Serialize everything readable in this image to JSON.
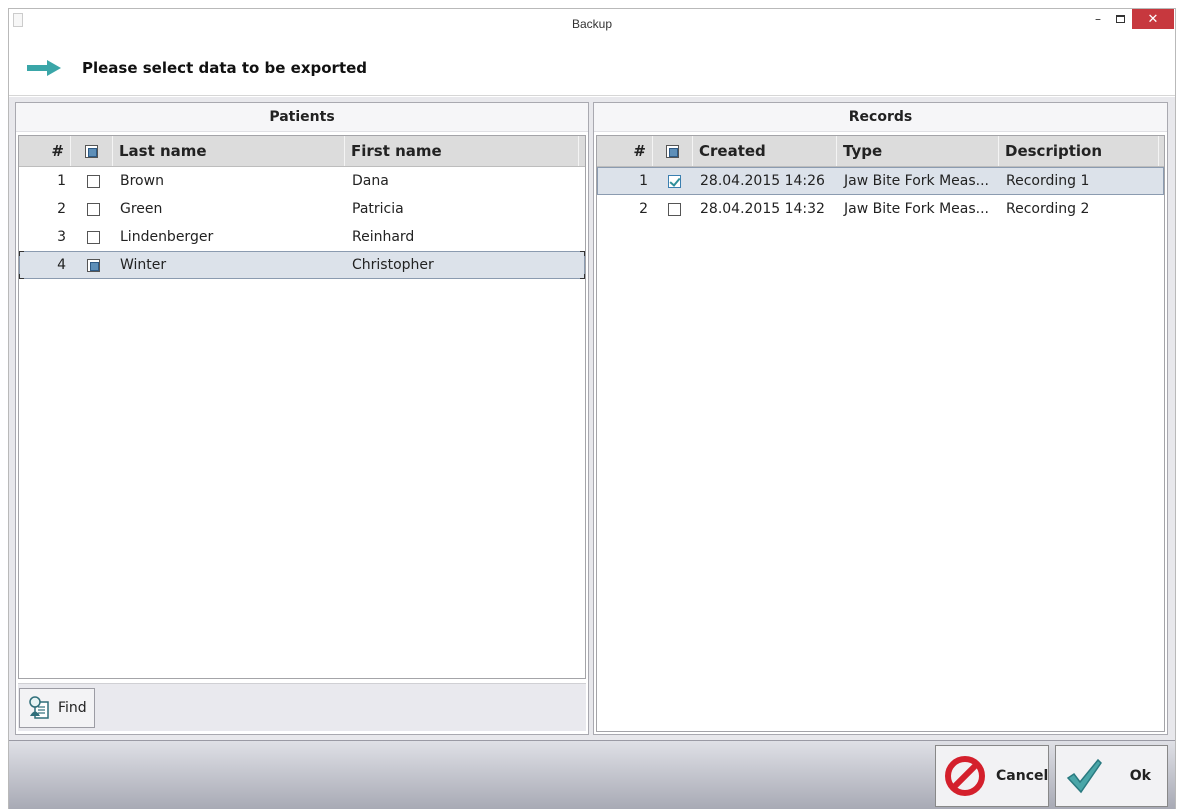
{
  "window": {
    "title": "Backup"
  },
  "instruction": {
    "text": "Please select data to be exported"
  },
  "patients": {
    "title": "Patients",
    "headers": {
      "num": "#",
      "last_name": "Last name",
      "first_name": "First name"
    },
    "rows": [
      {
        "num": "1",
        "last_name": "Brown",
        "first_name": "Dana",
        "checked": false
      },
      {
        "num": "2",
        "last_name": "Green",
        "first_name": "Patricia",
        "checked": false
      },
      {
        "num": "3",
        "last_name": "Lindenberger",
        "first_name": "Reinhard",
        "checked": false
      },
      {
        "num": "4",
        "last_name": "Winter",
        "first_name": "Christopher",
        "checked": "partial",
        "selected": true
      }
    ],
    "find_label": "Find"
  },
  "records": {
    "title": "Records",
    "headers": {
      "num": "#",
      "created": "Created",
      "type": "Type",
      "description": "Description"
    },
    "rows": [
      {
        "num": "1",
        "created": "28.04.2015 14:26",
        "type": "Jaw Bite Fork Meas...",
        "description": "Recording 1",
        "checked": true,
        "selected": true
      },
      {
        "num": "2",
        "created": "28.04.2015 14:32",
        "type": "Jaw Bite Fork Meas...",
        "description": "Recording 2",
        "checked": false
      }
    ]
  },
  "footer": {
    "cancel_label": "Cancel",
    "ok_label": "Ok"
  },
  "colors": {
    "accent": "#3aa6a8",
    "cancel": "#d4202c",
    "close": "#c7383e",
    "selection": "#dce2ea"
  },
  "icons": {
    "arrow": "right-arrow-icon",
    "find": "find-person-icon",
    "cancel": "prohibited-icon",
    "ok": "checkmark-icon"
  }
}
